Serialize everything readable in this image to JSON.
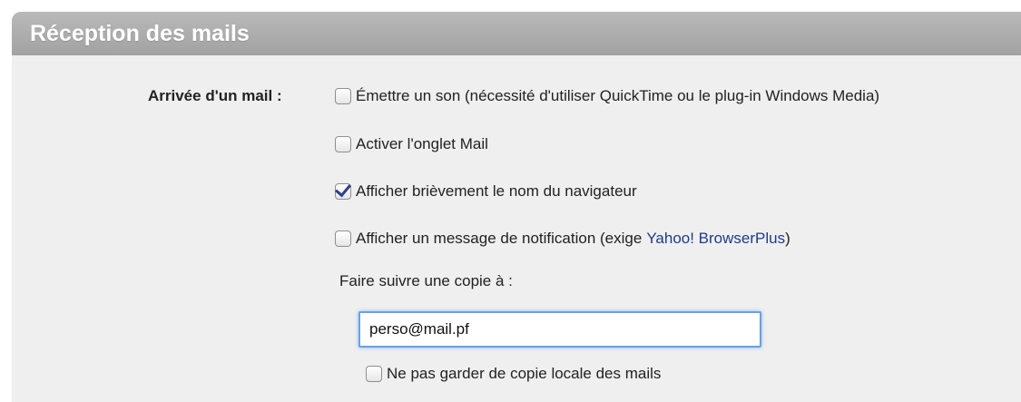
{
  "section": {
    "title": "Réception des mails"
  },
  "mail_arrival": {
    "label": "Arrivée d'un mail :",
    "options": [
      {
        "label": "Émettre un son (nécessité d'utiliser QuickTime ou le plug-in Windows Media)",
        "checked": false
      },
      {
        "label": "Activer l'onglet Mail",
        "checked": false
      },
      {
        "label": "Afficher brièvement le nom du navigateur",
        "checked": true
      },
      {
        "label": "Afficher un message de notification (exige",
        "link": "Yahoo! BrowserPlus",
        "suffix": ")",
        "checked": false
      }
    ]
  },
  "forward": {
    "label": "Faire suivre une copie à :",
    "value": "perso@mail.pf",
    "no_local_copy_label": "Ne pas garder de copie locale des mails",
    "no_local_copy_checked": false
  },
  "colors": {
    "header_bg": "#a8a8a8",
    "panel_bg": "#efefef",
    "link": "#1e3c8c",
    "input_focus": "#6aa0e8"
  }
}
